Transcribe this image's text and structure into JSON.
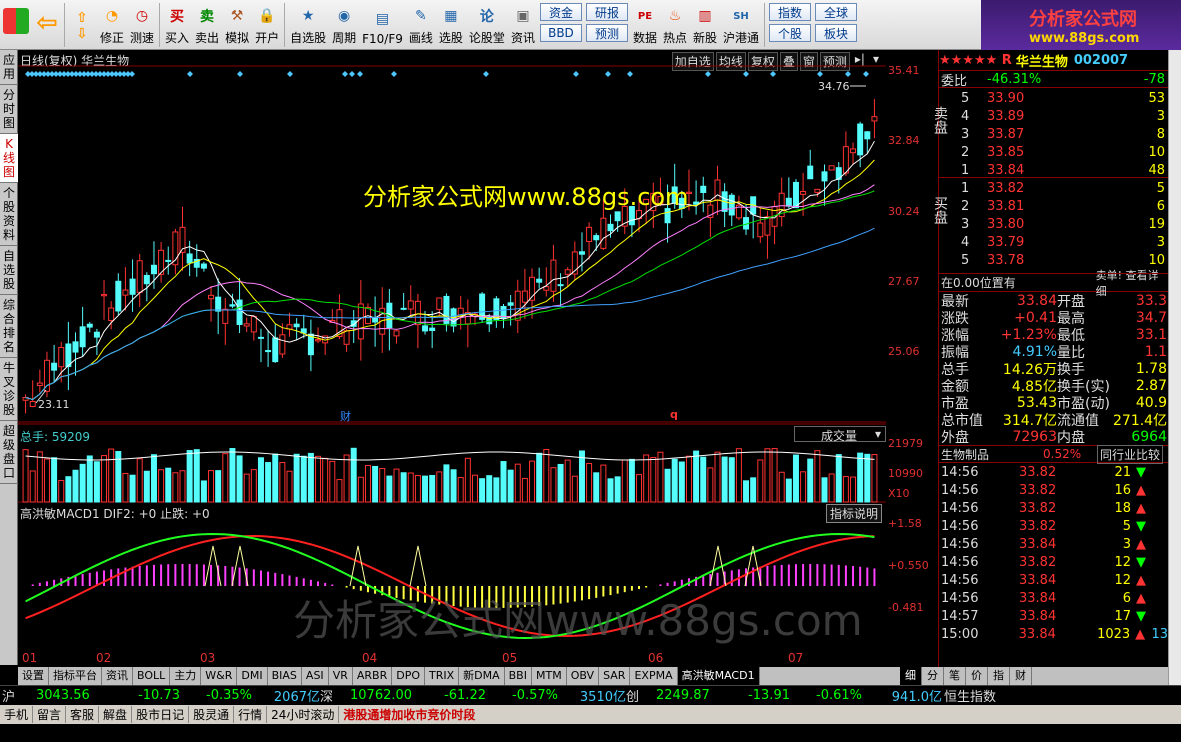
{
  "toolbar": {
    "items": [
      "修正",
      "测速",
      "买入",
      "卖出",
      "模拟",
      "开户",
      "自选股",
      "周期",
      "F10/F9",
      "画线",
      "选股",
      "论股堂",
      "资讯",
      "数据",
      "热点",
      "新股",
      "沪港通"
    ],
    "small_buttons": [
      [
        "资金",
        "BBD"
      ],
      [
        "研报",
        "预测"
      ],
      [
        "指数",
        "个股"
      ],
      [
        "全球",
        "板块"
      ]
    ]
  },
  "logo": {
    "title": "分析家公式网",
    "url": "www.88gs.com"
  },
  "sidetabs": [
    "应用",
    "分时图",
    "K线图",
    "个股资料",
    "自选股",
    "综合排名",
    "牛叉诊股",
    "超级盘口"
  ],
  "chart": {
    "header": "日线(复权) 华兰生物",
    "buttons": [
      "加自选",
      "均线",
      "复权",
      "叠",
      "窗",
      "预测"
    ],
    "max_label": "34.76",
    "min_label": "23.11",
    "watermark": "分析家公式网www.88gs.com",
    "watermark2": "分析家公式网www.88gs.com",
    "markers": [
      "财",
      "q"
    ],
    "price_axis": [
      "35.41",
      "32.84",
      "30.24",
      "27.67",
      "25.06"
    ],
    "vol_title": "总手: 59209",
    "vol_selector": "成交量",
    "vol_axis": [
      "21979",
      "10990",
      "X10"
    ],
    "macd_title": "高洪敏MACD1 DIF2: +0 止跌: +0",
    "macd_button": "指标说明",
    "macd_axis": [
      "+1.58",
      "+0.550",
      "-0.481"
    ],
    "months": [
      "01",
      "02",
      "03",
      "04",
      "05",
      "06",
      "07"
    ]
  },
  "chart_data": {
    "type": "candlestick",
    "title": "日线(复权) 华兰生物",
    "ylim": [
      23.11,
      35.41
    ],
    "price_axis": [
      35.41,
      32.84,
      30.24,
      27.67,
      25.06
    ],
    "high": 34.76,
    "low": 23.11,
    "last_close": 33.84,
    "volume_axis": [
      21979,
      10990
    ],
    "last_volume": 59209,
    "macd_axis": [
      1.58,
      0.55,
      -0.481
    ]
  },
  "quote": {
    "stars": "★★★★★ R",
    "name": "华兰生物",
    "code": "002007",
    "weibi_label": "委比",
    "weibi": "-46.31%",
    "weicha": "-78",
    "sell_label": "卖盘",
    "buy_label": "买盘",
    "sell": [
      [
        "5",
        "33.90",
        "53"
      ],
      [
        "4",
        "33.89",
        "3"
      ],
      [
        "3",
        "33.87",
        "8"
      ],
      [
        "2",
        "33.85",
        "10"
      ],
      [
        "1",
        "33.84",
        "48"
      ]
    ],
    "buy": [
      [
        "1",
        "33.82",
        "5"
      ],
      [
        "2",
        "33.81",
        "6"
      ],
      [
        "3",
        "33.80",
        "19"
      ],
      [
        "4",
        "33.79",
        "3"
      ],
      [
        "5",
        "33.78",
        "10"
      ]
    ],
    "pos_label": "在0.00位置有",
    "pos_link": "卖单! 查看详细",
    "stats": [
      [
        "最新",
        "33.84",
        "开盘",
        "33.3"
      ],
      [
        "涨跌",
        "+0.41",
        "最高",
        "34.7"
      ],
      [
        "涨幅",
        "+1.23%",
        "最低",
        "33.1"
      ],
      [
        "振幅",
        "4.91%",
        "量比",
        "1.1"
      ],
      [
        "总手",
        "14.26万",
        "换手",
        "1.78"
      ],
      [
        "金额",
        "4.85亿",
        "换手(实)",
        "2.87"
      ],
      [
        "市盈",
        "53.43",
        "市盈(动)",
        "40.9"
      ],
      [
        "总市值",
        "314.7亿",
        "流通值",
        "271.4亿"
      ],
      [
        "外盘",
        "72963",
        "内盘",
        "6964"
      ]
    ],
    "industry": "生物制品",
    "industry_pct": "0.52%",
    "compare": "同行业比较",
    "ticks": [
      [
        "14:56",
        "33.82",
        "21",
        "down"
      ],
      [
        "14:56",
        "33.82",
        "16",
        "up"
      ],
      [
        "14:56",
        "33.82",
        "18",
        "up"
      ],
      [
        "14:56",
        "33.82",
        "5",
        "down"
      ],
      [
        "14:56",
        "33.84",
        "3",
        "up"
      ],
      [
        "14:56",
        "33.82",
        "12",
        "down"
      ],
      [
        "14:56",
        "33.84",
        "12",
        "up"
      ],
      [
        "14:56",
        "33.84",
        "6",
        "up"
      ],
      [
        "14:57",
        "33.84",
        "17",
        "down"
      ],
      [
        "15:00",
        "33.84",
        "1023",
        "up"
      ]
    ],
    "tick_extra": "13"
  },
  "bottomtabs": [
    "设置",
    "指标平台",
    "资讯",
    "BOLL",
    "主力",
    "W&R",
    "DMI",
    "BIAS",
    "ASI",
    "VR",
    "ARBR",
    "DPO",
    "TRIX",
    "新DMA",
    "BBI",
    "MTM",
    "OBV",
    "SAR",
    "EXPMA",
    "高洪敏MACD1"
  ],
  "righttabs": [
    "细",
    "分",
    "笔",
    "价",
    "指",
    "财"
  ],
  "statusbar": {
    "sh_label": "沪",
    "sh_val": "3043.56",
    "sh_chg": "-10.73",
    "sh_pct": "-0.35%",
    "sh_amt": "2067亿",
    "sz_label": "深",
    "sz_val": "10762.00",
    "sz_chg": "-61.22",
    "sz_pct": "-0.57%",
    "sz_amt": "3510亿",
    "cy_label": "创",
    "cy_val": "2249.87",
    "cy_chg": "-13.91",
    "cy_pct": "-0.61%",
    "cy_amt": "941.0亿",
    "hs_label": "恒生指数"
  },
  "footer": [
    "手机",
    "留言",
    "客服",
    "解盘",
    "股市日记",
    "股灵通",
    "行情",
    "24小时滚动"
  ],
  "footer_news": "港股通增加收市竞价时段"
}
